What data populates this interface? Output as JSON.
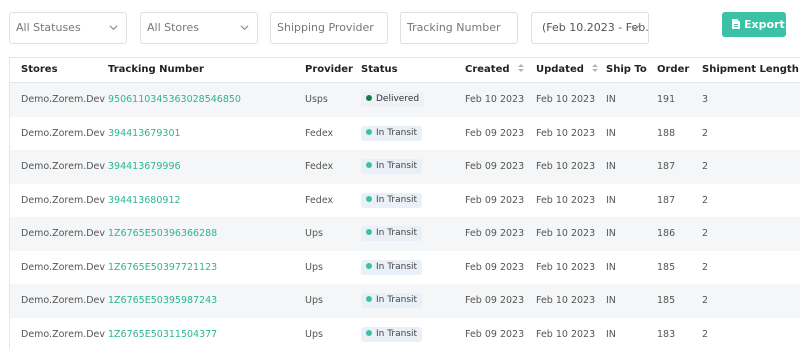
{
  "filters": {
    "status_select": "All Statuses",
    "stores_select": "All Stores",
    "shipping_provider_placeholder": "Shipping Provider",
    "tracking_number_placeholder": "Tracking Number",
    "date_range": "(Feb 10.2023 - Feb..."
  },
  "export_label": "Export",
  "colors": {
    "accent": "#3bc1a3",
    "link": "#2bb593",
    "delivered_dot": "#1a7a4c",
    "transit_dot": "#3bc1a3"
  },
  "columns": {
    "stores": "Stores",
    "tracking_number": "Tracking Number",
    "provider": "Provider",
    "status": "Status",
    "created": "Created",
    "updated": "Updated",
    "ship_to": "Ship To",
    "order": "Order",
    "shipment_length": "Shipment Length"
  },
  "rows": [
    {
      "store": "Demo.Zorem.Dev",
      "tracking": "9506110345363028546850",
      "provider": "Usps",
      "status": "Delivered",
      "status_type": "delivered",
      "created": "Feb 10 2023",
      "updated": "Feb 10 2023",
      "ship_to": "IN",
      "order": "191",
      "length": "3"
    },
    {
      "store": "Demo.Zorem.Dev",
      "tracking": "394413679301",
      "provider": "Fedex",
      "status": "In Transit",
      "status_type": "transit",
      "created": "Feb 09 2023",
      "updated": "Feb 10 2023",
      "ship_to": "IN",
      "order": "188",
      "length": "2"
    },
    {
      "store": "Demo.Zorem.Dev",
      "tracking": "394413679996",
      "provider": "Fedex",
      "status": "In Transit",
      "status_type": "transit",
      "created": "Feb 09 2023",
      "updated": "Feb 10 2023",
      "ship_to": "IN",
      "order": "187",
      "length": "2"
    },
    {
      "store": "Demo.Zorem.Dev",
      "tracking": "394413680912",
      "provider": "Fedex",
      "status": "In Transit",
      "status_type": "transit",
      "created": "Feb 09 2023",
      "updated": "Feb 10 2023",
      "ship_to": "IN",
      "order": "187",
      "length": "2"
    },
    {
      "store": "Demo.Zorem.Dev",
      "tracking": "1Z6765E50396366288",
      "provider": "Ups",
      "status": "In Transit",
      "status_type": "transit",
      "created": "Feb 09 2023",
      "updated": "Feb 10 2023",
      "ship_to": "IN",
      "order": "186",
      "length": "2"
    },
    {
      "store": "Demo.Zorem.Dev",
      "tracking": "1Z6765E50397721123",
      "provider": "Ups",
      "status": "In Transit",
      "status_type": "transit",
      "created": "Feb 09 2023",
      "updated": "Feb 10 2023",
      "ship_to": "IN",
      "order": "185",
      "length": "2"
    },
    {
      "store": "Demo.Zorem.Dev",
      "tracking": "1Z6765E50395987243",
      "provider": "Ups",
      "status": "In Transit",
      "status_type": "transit",
      "created": "Feb 09 2023",
      "updated": "Feb 10 2023",
      "ship_to": "IN",
      "order": "185",
      "length": "2"
    },
    {
      "store": "Demo.Zorem.Dev",
      "tracking": "1Z6765E50311504377",
      "provider": "Ups",
      "status": "In Transit",
      "status_type": "transit",
      "created": "Feb 09 2023",
      "updated": "Feb 10 2023",
      "ship_to": "IN",
      "order": "183",
      "length": "2"
    }
  ]
}
